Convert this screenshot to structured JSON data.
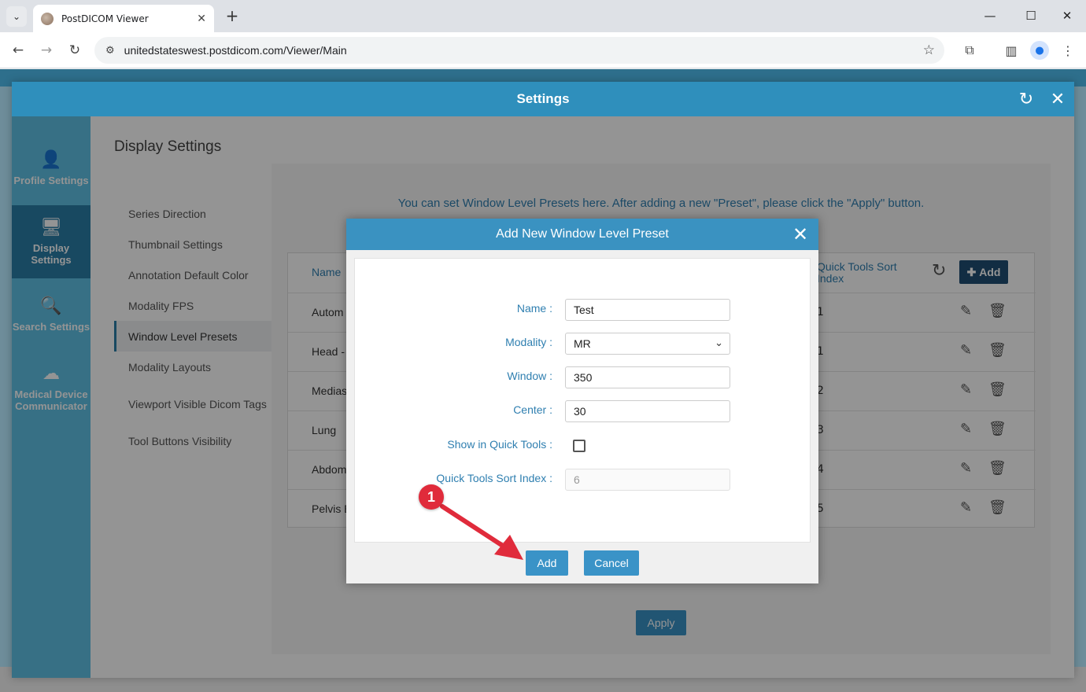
{
  "browser": {
    "tab_title": "PostDICOM Viewer",
    "url": "unitedstateswest.postdicom.com/Viewer/Main"
  },
  "settings": {
    "title": "Settings",
    "sidebar": [
      {
        "label": "Profile Settings",
        "icon": "person-icon"
      },
      {
        "label": "Display Settings",
        "icon": "monitor-gear-icon"
      },
      {
        "label": "Search Settings",
        "icon": "search-gear-icon"
      },
      {
        "label": "Medical Device Communicator",
        "icon": "cloud-icon"
      }
    ],
    "content_title": "Display Settings",
    "menu": [
      "Series Direction",
      "Thumbnail Settings",
      "Annotation Default Color",
      "Modality FPS",
      "Window Level Presets",
      "Modality Layouts",
      "Viewport Visible Dicom Tags",
      "Tool Buttons Visibility"
    ],
    "active_menu": "Window Level Presets",
    "info_text": "You can set Window Level Presets here. After adding a new \"Preset\", please click the \"Apply\" button.",
    "table": {
      "col_name": "Name",
      "col_quick_tools": "Quick Tools Sort Index",
      "add_label": "Add",
      "rows": [
        {
          "name": "Autom",
          "index": "1"
        },
        {
          "name": "Head -",
          "index": "1"
        },
        {
          "name": "Medias",
          "index": "2"
        },
        {
          "name": "Lung",
          "index": "3"
        },
        {
          "name": "Abdom",
          "index": "4"
        },
        {
          "name": "Pelvis E",
          "index": "5"
        }
      ]
    },
    "apply_label": "Apply"
  },
  "modal": {
    "title": "Add New Window Level Preset",
    "fields": {
      "name_label": "Name :",
      "name_value": "Test",
      "modality_label": "Modality :",
      "modality_value": "MR",
      "window_label": "Window :",
      "window_value": "350",
      "center_label": "Center :",
      "center_value": "30",
      "show_quick_label": "Show in Quick Tools :",
      "show_quick_checked": false,
      "sort_index_label": "Quick Tools Sort Index :",
      "sort_index_value": "6"
    },
    "add_label": "Add",
    "cancel_label": "Cancel"
  },
  "annotation": {
    "step": "1",
    "color": "#e02b3b"
  }
}
